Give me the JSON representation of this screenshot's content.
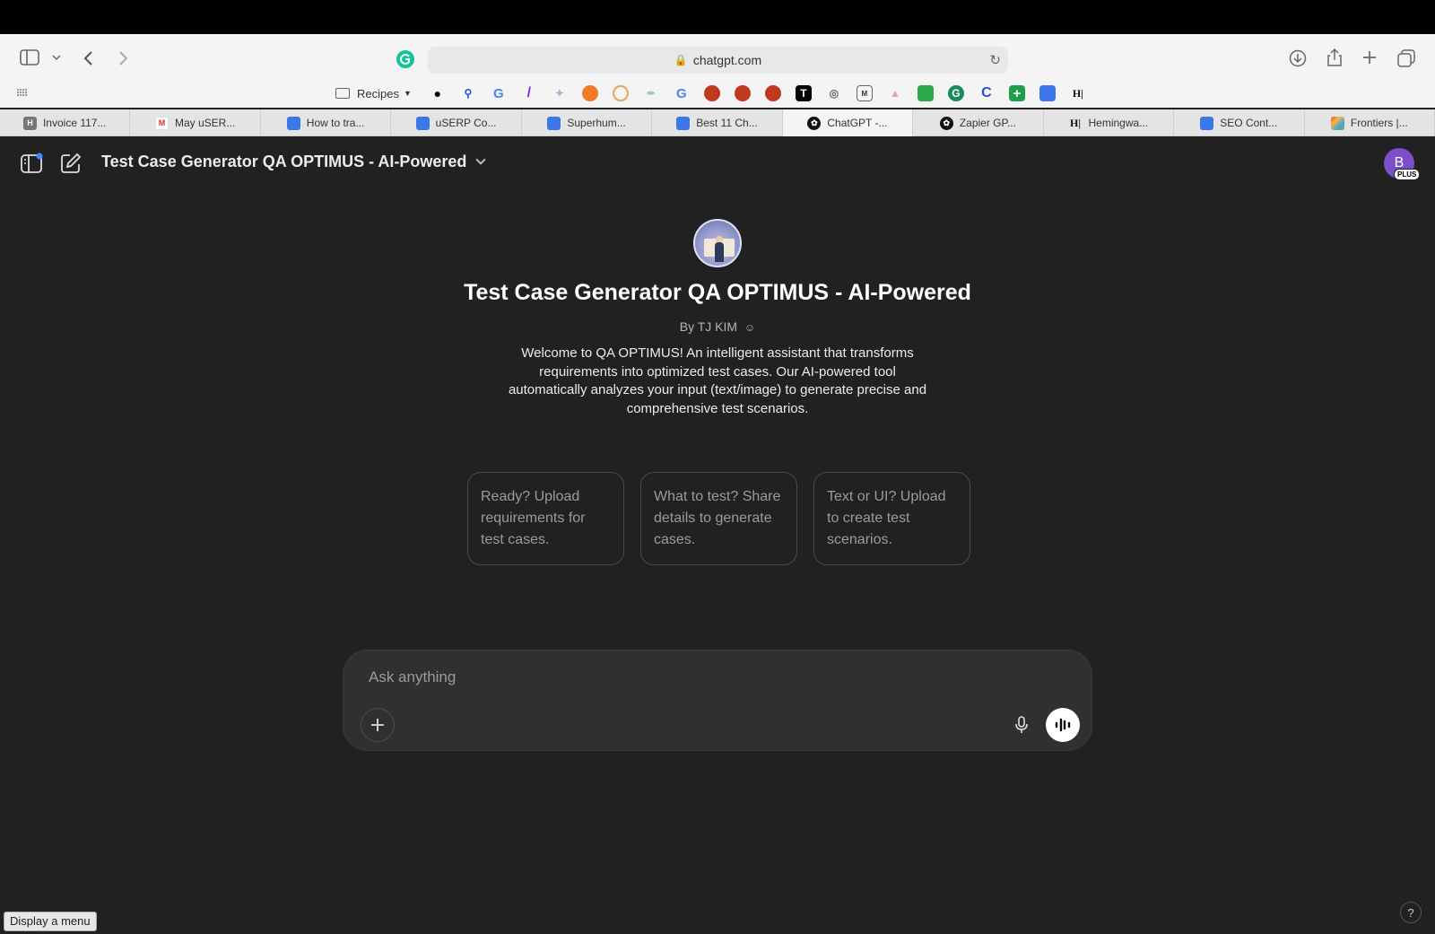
{
  "browser": {
    "url": "chatgpt.com",
    "bookmarks_folder": "Recipes",
    "tabs": [
      {
        "label": "Invoice 117...",
        "icon": "h-icon"
      },
      {
        "label": "May uSER...",
        "icon": "gmail-icon"
      },
      {
        "label": "How to tra...",
        "icon": "docs-icon"
      },
      {
        "label": "uSERP Co...",
        "icon": "docs-icon"
      },
      {
        "label": "Superhum...",
        "icon": "docs-icon"
      },
      {
        "label": "Best 11 Ch...",
        "icon": "docs-icon"
      },
      {
        "label": "ChatGPT -...",
        "icon": "openai-icon",
        "active": true
      },
      {
        "label": "Zapier GP...",
        "icon": "openai-icon"
      },
      {
        "label": "Hemingwa...",
        "icon": "hemingway-icon"
      },
      {
        "label": "SEO Cont...",
        "icon": "docs-icon"
      },
      {
        "label": "Frontiers |...",
        "icon": "frontiers-icon"
      }
    ]
  },
  "header": {
    "title": "Test Case Generator QA OPTIMUS - AI-Powered",
    "avatar_letter": "B",
    "plan_badge": "PLUS"
  },
  "gpt": {
    "name": "Test Case Generator QA OPTIMUS - AI-Powered",
    "byline": "By TJ KIM",
    "description": "Welcome to QA OPTIMUS! An intelligent assistant that transforms requirements into optimized test cases. Our AI-powered tool automatically analyzes your input (text/image) to generate precise and comprehensive test scenarios.",
    "starters": [
      "Ready? Upload requirements for test cases.",
      "What to test? Share details to generate cases.",
      "Text or UI? Upload to create test scenarios."
    ]
  },
  "composer": {
    "placeholder": "Ask anything"
  },
  "status_tooltip": "Display a menu",
  "help_label": "?",
  "colors": {
    "background": "#212121",
    "composer": "#303030",
    "accent_avatar": "#7b4fc9"
  }
}
